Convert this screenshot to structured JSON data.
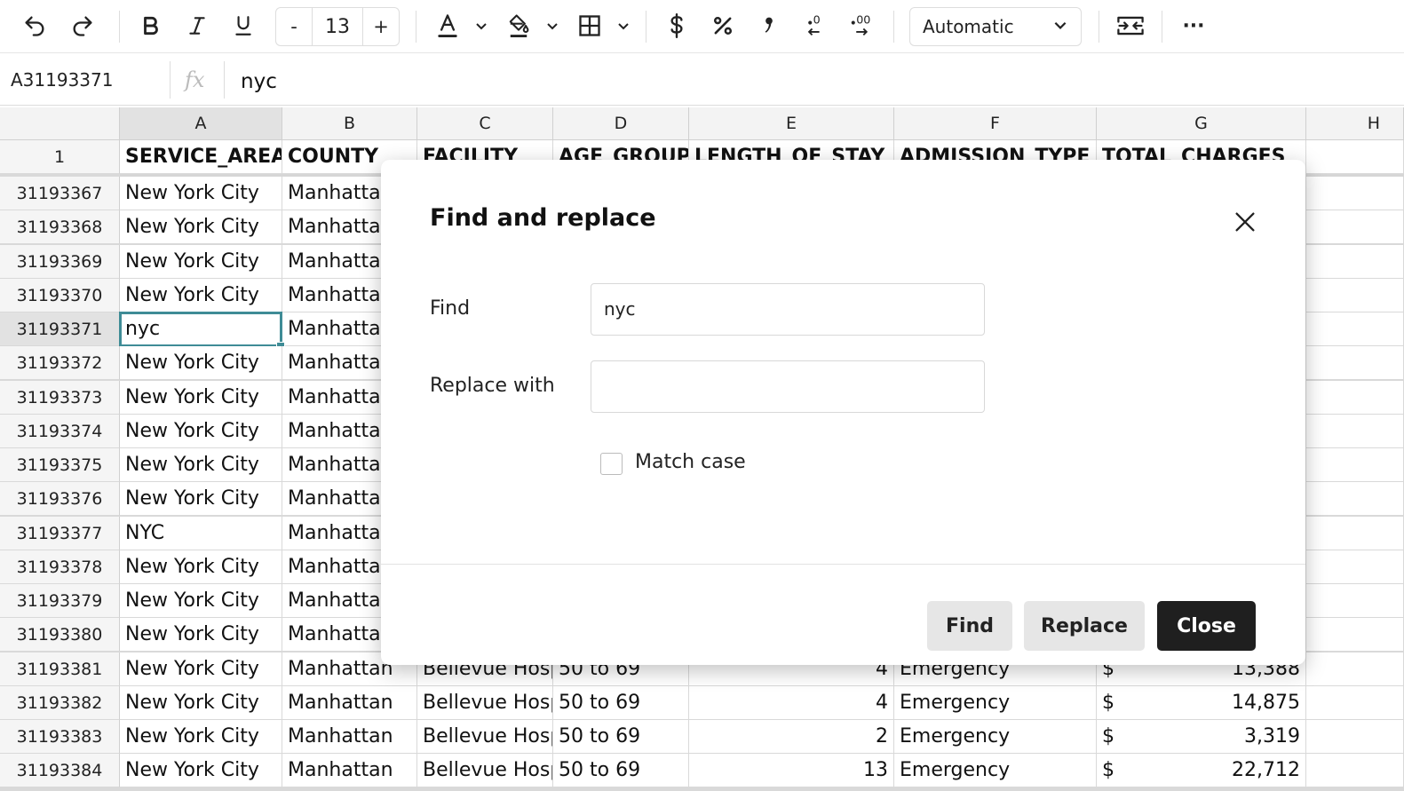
{
  "toolbar": {
    "font_size": "13",
    "decrease_label": "-",
    "increase_label": "+",
    "number_format": "Automatic",
    "more_label": "···"
  },
  "formula_bar": {
    "cell_ref": "A31193371",
    "fx_label": "fx",
    "value": "nyc"
  },
  "columns": [
    "A",
    "B",
    "C",
    "D",
    "E",
    "F",
    "G",
    "H"
  ],
  "header_row": {
    "num": "1",
    "cells": [
      "SERVICE_AREA",
      "COUNTY",
      "FACILITY",
      "AGE_GROUP",
      "LENGTH_OF_STAY",
      "ADMISSION_TYPE",
      "TOTAL_CHARGES"
    ]
  },
  "rows": [
    {
      "num": "31193367",
      "a": "New York City",
      "b": "Manhattan",
      "c": "",
      "d": "",
      "e": "",
      "f": "",
      "g1": "",
      "g2": ""
    },
    {
      "num": "31193368",
      "a": "New York City",
      "b": "Manhattan",
      "c": "",
      "d": "",
      "e": "",
      "f": "",
      "g1": "",
      "g2": ""
    },
    {
      "num": "31193369",
      "a": "New York City",
      "b": "Manhattan",
      "c": "",
      "d": "",
      "e": "",
      "f": "",
      "g1": "",
      "g2": ""
    },
    {
      "num": "31193370",
      "a": "New York City",
      "b": "Manhattan",
      "c": "",
      "d": "",
      "e": "",
      "f": "",
      "g1": "",
      "g2": ""
    },
    {
      "num": "31193371",
      "a": "nyc",
      "b": "Manhattan",
      "c": "",
      "d": "",
      "e": "",
      "f": "",
      "g1": "",
      "g2": ""
    },
    {
      "num": "31193372",
      "a": "New York City",
      "b": "Manhattan",
      "c": "",
      "d": "",
      "e": "",
      "f": "",
      "g1": "",
      "g2": ""
    },
    {
      "num": "31193373",
      "a": "New York City",
      "b": "Manhattan",
      "c": "",
      "d": "",
      "e": "",
      "f": "",
      "g1": "",
      "g2": ""
    },
    {
      "num": "31193374",
      "a": "New York City",
      "b": "Manhattan",
      "c": "",
      "d": "",
      "e": "",
      "f": "",
      "g1": "",
      "g2": ""
    },
    {
      "num": "31193375",
      "a": "New York City",
      "b": "Manhattan",
      "c": "",
      "d": "",
      "e": "",
      "f": "",
      "g1": "",
      "g2": ""
    },
    {
      "num": "31193376",
      "a": "New York City",
      "b": "Manhattan",
      "c": "",
      "d": "",
      "e": "",
      "f": "",
      "g1": "",
      "g2": ""
    },
    {
      "num": "31193377",
      "a": "NYC",
      "b": "Manhattan",
      "c": "",
      "d": "",
      "e": "",
      "f": "",
      "g1": "",
      "g2": ""
    },
    {
      "num": "31193378",
      "a": "New York City",
      "b": "Manhattan",
      "c": "",
      "d": "",
      "e": "",
      "f": "",
      "g1": "",
      "g2": ""
    },
    {
      "num": "31193379",
      "a": "New York City",
      "b": "Manhattan",
      "c": "",
      "d": "",
      "e": "",
      "f": "",
      "g1": "",
      "g2": ""
    },
    {
      "num": "31193380",
      "a": "New York City",
      "b": "Manhattan",
      "c": "",
      "d": "",
      "e": "",
      "f": "",
      "g1": "",
      "g2": ""
    },
    {
      "num": "31193381",
      "a": "New York City",
      "b": "Manhattan",
      "c": "Bellevue Hosp",
      "d": "50 to 69",
      "e": "4",
      "f": "Emergency",
      "g1": "$",
      "g2": "13,388"
    },
    {
      "num": "31193382",
      "a": "New York City",
      "b": "Manhattan",
      "c": "Bellevue Hosp",
      "d": "50 to 69",
      "e": "4",
      "f": "Emergency",
      "g1": "$",
      "g2": "14,875"
    },
    {
      "num": "31193383",
      "a": "New York City",
      "b": "Manhattan",
      "c": "Bellevue Hosp",
      "d": "50 to 69",
      "e": "2",
      "f": "Emergency",
      "g1": "$",
      "g2": "3,319"
    },
    {
      "num": "31193384",
      "a": "New York City",
      "b": "Manhattan",
      "c": "Bellevue Hosp",
      "d": "50 to 69",
      "e": "13",
      "f": "Emergency",
      "g1": "$",
      "g2": "22,712"
    }
  ],
  "dialog": {
    "title": "Find and replace",
    "find_label": "Find",
    "find_value": "nyc",
    "replace_label": "Replace with",
    "replace_value": "",
    "match_case_label": "Match case",
    "find_button": "Find",
    "replace_button": "Replace",
    "close_button": "Close"
  },
  "colors": {
    "selection": "#3f8c96",
    "primary_button": "#1f1f1f"
  }
}
